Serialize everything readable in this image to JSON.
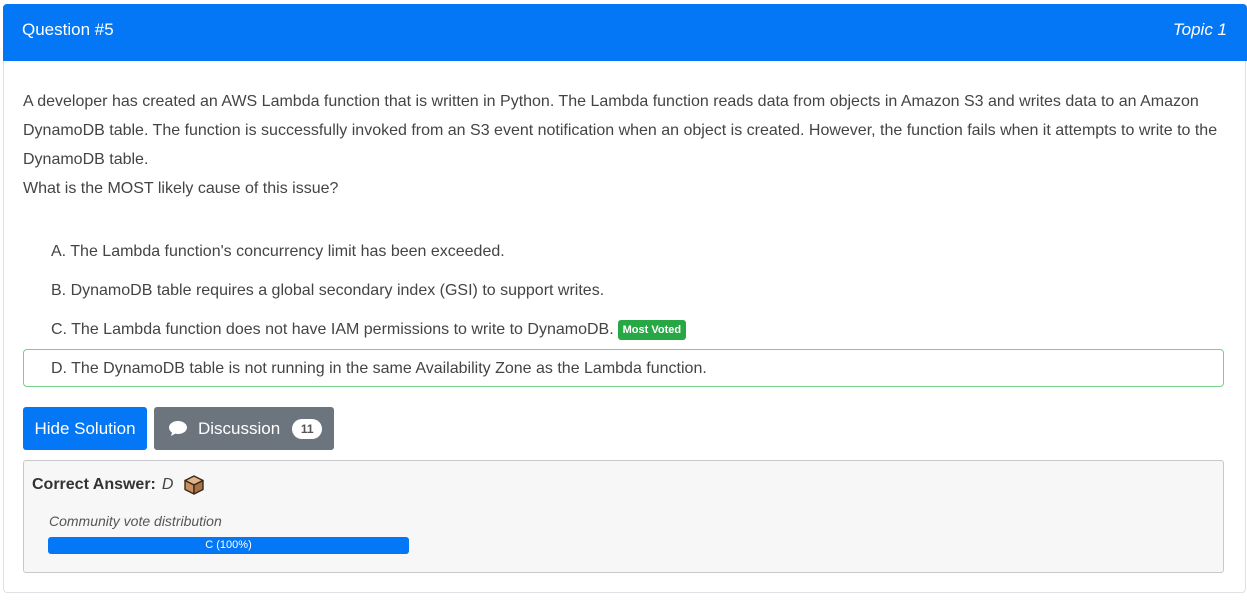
{
  "header": {
    "question_title": "Question #5",
    "topic": "Topic 1",
    "bg_color": "#0477f7"
  },
  "question": {
    "text": "A developer has created an AWS Lambda function that is written in Python. The Lambda function reads data from objects in Amazon S3 and writes data to an Amazon DynamoDB table. The function is successfully invoked from an S3 event notification when an object is created. However, the function fails when it attempts to write to the DynamoDB table.",
    "prompt": "What is the MOST likely cause of this issue?"
  },
  "choices": [
    {
      "text": "A. The Lambda function's concurrency limit has been exceeded."
    },
    {
      "text": "B. DynamoDB table requires a global secondary index (GSI) to support writes."
    },
    {
      "text": "C. The Lambda function does not have IAM permissions to write to DynamoDB.",
      "badge": "Most Voted"
    },
    {
      "text": "D. The DynamoDB table is not running in the same Availability Zone as the Lambda function.",
      "highlighted": true
    }
  ],
  "buttons": {
    "hide_solution": "Hide Solution",
    "discussion": "Discussion",
    "discussion_count": "11"
  },
  "answer": {
    "label": "Correct Answer:",
    "value": "D",
    "icon": "box-icon",
    "vote_label": "Community vote distribution",
    "vote_bar_text": "C (100%)",
    "vote_percent": 100
  },
  "colors": {
    "primary": "#0477f7",
    "secondary": "#6c757d",
    "success": "#28a745",
    "highlight_border": "#77d08a"
  }
}
